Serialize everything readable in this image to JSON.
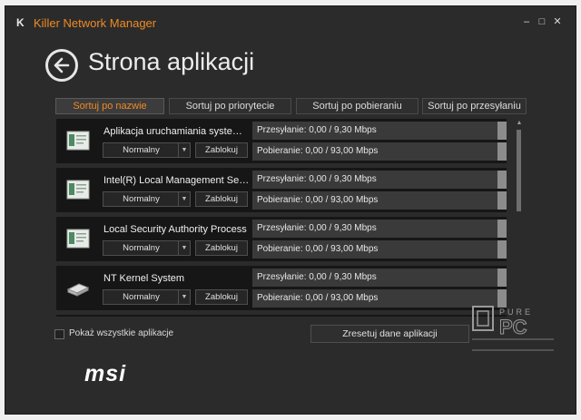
{
  "window": {
    "title": "Killer Network Manager",
    "logo_letter": "K",
    "controls": {
      "minimize": "–",
      "maximize": "□",
      "close": "✕"
    }
  },
  "page": {
    "back_icon": "back-arrow-icon",
    "title": "Strona aplikacji"
  },
  "sort_tabs": [
    {
      "label": "Sortuj po nazwie",
      "active": true
    },
    {
      "label": "Sortuj po priorytecie",
      "active": false
    },
    {
      "label": "Sortuj po pobieraniu",
      "active": false
    },
    {
      "label": "Sortuj po przesyłaniu",
      "active": false
    }
  ],
  "apps": [
    {
      "name": "Aplikacja uruchamiania systemu...",
      "icon": "app-window-icon",
      "priority": "Normalny",
      "block_label": "Zablokuj",
      "upload": "Przesyłanie: 0,00 / 9,30 Mbps",
      "download": "Pobieranie: 0,00 / 93,00 Mbps"
    },
    {
      "name": "Intel(R) Local Management Serv...",
      "icon": "app-window-icon",
      "priority": "Normalny",
      "block_label": "Zablokuj",
      "upload": "Przesyłanie: 0,00 / 9,30 Mbps",
      "download": "Pobieranie: 0,00 / 93,00 Mbps"
    },
    {
      "name": "Local Security Authority Process",
      "icon": "app-window-icon",
      "priority": "Normalny",
      "block_label": "Zablokuj",
      "upload": "Przesyłanie: 0,00 / 9,30 Mbps",
      "download": "Pobieranie: 0,00 / 93,00 Mbps"
    },
    {
      "name": "NT Kernel  System",
      "icon": "hardware-drive-icon",
      "priority": "Normalny",
      "block_label": "Zablokuj",
      "upload": "Przesyłanie: 0,00 / 9,30 Mbps",
      "download": "Pobieranie: 0,00 / 93,00 Mbps"
    }
  ],
  "footer": {
    "show_all_label": "Pokaż wszystkie aplikacje",
    "reset_label": "Zresetuj dane aplikacji"
  },
  "brand": {
    "logo": "msi"
  },
  "colors": {
    "accent": "#f08a24",
    "background": "#2b2b2b",
    "row": "#161616"
  }
}
